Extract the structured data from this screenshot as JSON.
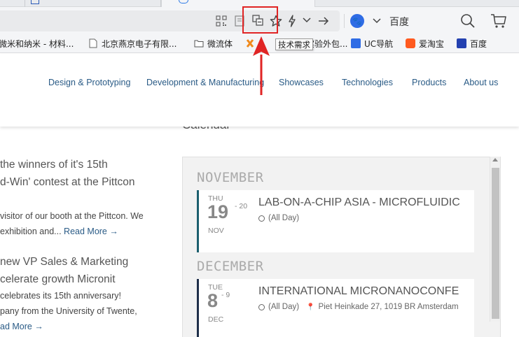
{
  "browser": {
    "toolbar_icons": [
      "qr-code-icon",
      "reader-icon",
      "screenshot-icon",
      "star-icon",
      "lightning-icon",
      "chevron-down-icon",
      "forward-icon"
    ],
    "search_engine_label": "百度",
    "tooltip_text": "技术需求"
  },
  "bookmarks": [
    {
      "label": "微米和纳米 - 材料...",
      "icon": "blank"
    },
    {
      "label": "北京燕京电子有限...",
      "icon": "page"
    },
    {
      "label": "微流体",
      "icon": "folder"
    },
    {
      "label": "实验外包...",
      "icon": "orange"
    },
    {
      "label": "UC导航",
      "icon": "uc"
    },
    {
      "label": "爱淘宝",
      "icon": "taobao"
    },
    {
      "label": "百度",
      "icon": "baidu"
    }
  ],
  "nav": {
    "items": [
      "Design & Prototyping",
      "Development & Manufacturing",
      "Showcases",
      "Technologies",
      "Products",
      "About us"
    ]
  },
  "calendar": {
    "heading": "Calendar",
    "months": [
      {
        "name": "NOVEMBER",
        "event": {
          "dow": "THU",
          "day": "19",
          "end": "- 20",
          "mon": "NOV",
          "title": "LAB-ON-A-CHIP ASIA - MICROFLUIDIC",
          "time": "(All Day)",
          "location": ""
        }
      },
      {
        "name": "DECEMBER",
        "event": {
          "dow": "TUE",
          "day": "8",
          "end": "- 9",
          "mon": "DEC",
          "title": "INTERNATIONAL MICRONANOCONFE",
          "time": "(All Day)",
          "location": "Piet Heinkade 27, 1019 BR Amsterdam"
        }
      }
    ]
  },
  "news": {
    "item1": {
      "title_line1": "the winners of it's 15th",
      "title_line2": "d-Win' contest at the Pittcon",
      "text_line1": "visitor of our booth at the Pittcon. We",
      "text_line2": "exhibition and...",
      "read_more": "Read More →"
    },
    "item2": {
      "title_line1": "new VP Sales & Marketing",
      "title_line2": "celerate growth Micronit",
      "text_line1": "celebrates its 15th anniversary!",
      "text_line2": "pany from the University of Twente,",
      "read_more": "ad More →"
    }
  },
  "colors": {
    "nav_link": "#2a5b86",
    "highlight": "#e02424",
    "event_border_1": "#1c5f6e",
    "event_border_2": "#1f2f4a"
  }
}
